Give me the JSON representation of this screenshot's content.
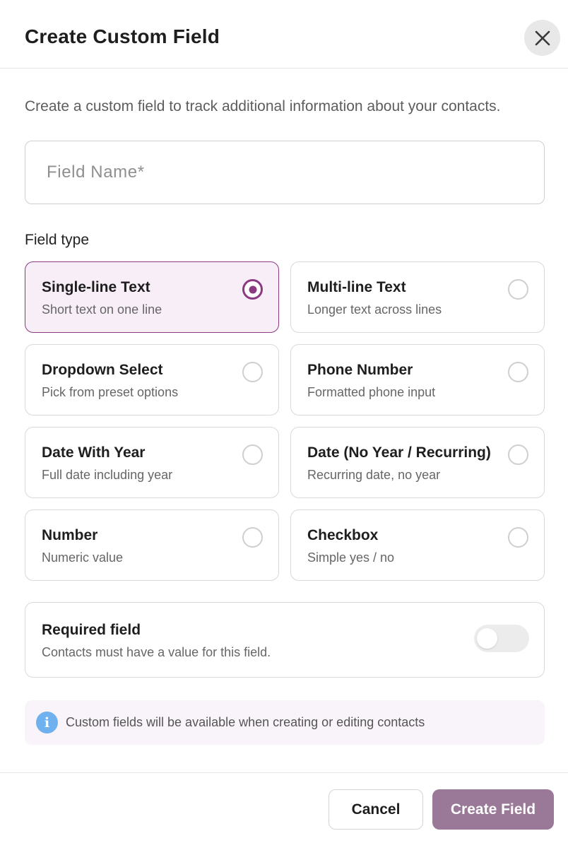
{
  "dialog": {
    "title": "Create Custom Field",
    "close_icon": "close-icon",
    "description": "Create a custom field to track additional information about your contacts."
  },
  "field_name": {
    "placeholder": "Field Name*",
    "value": ""
  },
  "field_type": {
    "label": "Field type",
    "selected": "Single-line Text",
    "options": [
      {
        "title": "Single-line Text",
        "subtitle": "Short text on one line",
        "checked": true
      },
      {
        "title": "Multi-line Text",
        "subtitle": "Longer text across lines",
        "checked": false
      },
      {
        "title": "Dropdown Select",
        "subtitle": "Pick from preset options",
        "checked": false
      },
      {
        "title": "Phone Number",
        "subtitle": "Formatted phone input",
        "checked": false
      },
      {
        "title": "Date With Year",
        "subtitle": "Full date including year",
        "checked": false
      },
      {
        "title": "Date (No Year / Recurring)",
        "subtitle": "Recurring date, no year",
        "checked": false
      },
      {
        "title": "Number",
        "subtitle": "Numeric value",
        "checked": false
      },
      {
        "title": "Checkbox",
        "subtitle": "Simple yes / no",
        "checked": false
      }
    ]
  },
  "required": {
    "title": "Required field",
    "subtitle": "Contacts must have a value for this field.",
    "enabled": false
  },
  "info": {
    "icon": "info-icon",
    "icon_glyph": "i",
    "text": "Custom fields will be available when creating or editing contacts"
  },
  "footer": {
    "cancel_label": "Cancel",
    "create_label": "Create Field"
  },
  "colors": {
    "accent": "#8b3a82",
    "selected_bg": "#f8eef7",
    "create_button": "#9a7897",
    "info_icon": "#6fb0ef"
  }
}
